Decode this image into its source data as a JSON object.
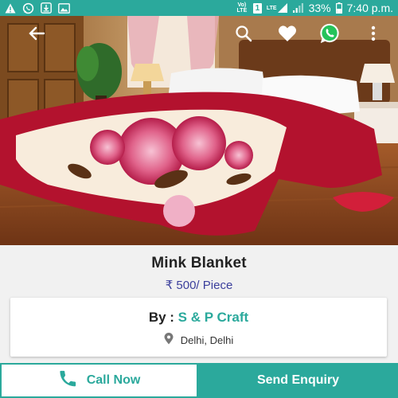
{
  "status_bar": {
    "left_icons": [
      "warning-icon",
      "whatsapp-notification-icon",
      "download-notification-icon",
      "image-notification-icon"
    ],
    "volte_label": "Vo) LTE",
    "sim_number": "1",
    "lte_label": "LTE",
    "battery": "33%",
    "time": "7:40 p.m."
  },
  "toolbar": {
    "icons": [
      "back-arrow-icon",
      "search-icon",
      "wishlist-heart-icon",
      "whatsapp-icon",
      "more-vert-icon"
    ]
  },
  "product": {
    "title": "Mink Blanket",
    "price": "₹ 500/ Piece"
  },
  "seller": {
    "by_label": "By :",
    "name": "S & P Craft",
    "location": "Delhi, Delhi"
  },
  "actions": {
    "call_label": "Call Now",
    "enquiry_label": "Send Enquiry"
  },
  "colors": {
    "accent": "#2ba99c",
    "price": "#3b3f9c",
    "blanket_red": "#b3122e"
  }
}
